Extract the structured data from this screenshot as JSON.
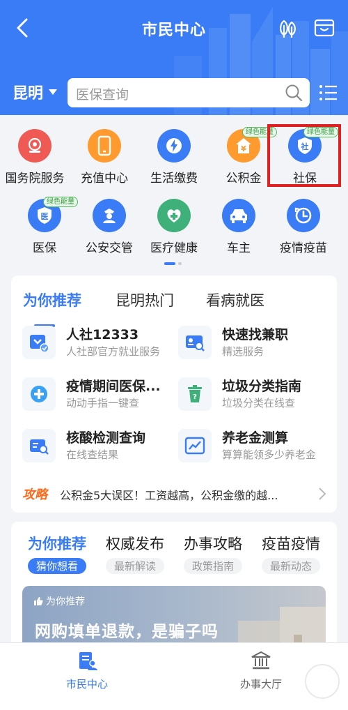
{
  "header": {
    "title": "市民中心",
    "city": "昆明",
    "search_placeholder": "医保查询"
  },
  "services": [
    {
      "label": "国务院服务",
      "icon": "state-council-icon",
      "color": "#ef5350"
    },
    {
      "label": "充值中心",
      "icon": "phone-recharge-icon",
      "color": "#ff9a2e"
    },
    {
      "label": "生活缴费",
      "icon": "lightning-icon",
      "color": "#3a7cf5"
    },
    {
      "label": "公积金",
      "icon": "yuan-house-icon",
      "color": "#ff9a2e",
      "badge": "绿色能量"
    },
    {
      "label": "社保",
      "icon": "social-security-shield-icon",
      "color": "#3a7cf5",
      "badge": "绿色能量"
    },
    {
      "label": "医保",
      "icon": "medical-insurance-shield-icon",
      "color": "#3a7cf5",
      "badge": "绿色能量"
    },
    {
      "label": "公安交管",
      "icon": "police-icon",
      "color": "#3a7cf5"
    },
    {
      "label": "医疗健康",
      "icon": "heart-cross-icon",
      "color": "#3fb07a"
    },
    {
      "label": "车主",
      "icon": "car-icon",
      "color": "#3a7cf5"
    },
    {
      "label": "疫情疫苗",
      "icon": "clock-icon",
      "color": "#3a7cf5"
    }
  ],
  "recommend": {
    "tabs": [
      "为你推荐",
      "昆明热门",
      "看病就医"
    ],
    "items": [
      {
        "title": "人社12333",
        "subtitle": "人社部官方就业服务",
        "icon": "download-check-icon"
      },
      {
        "title": "快速找兼职",
        "subtitle": "精选服务",
        "icon": "id-card-search-icon"
      },
      {
        "title": "疫情期间医保...",
        "subtitle": "动动手指一键查",
        "icon": "plus-circle-icon"
      },
      {
        "title": "垃圾分类指南",
        "subtitle": "垃圾分类在线查",
        "icon": "trash-bin-icon"
      },
      {
        "title": "核酸检测查询",
        "subtitle": "在线查结果",
        "icon": "test-search-icon"
      },
      {
        "title": "养老金测算",
        "subtitle": "算算能领多少养老金",
        "icon": "line-chart-icon"
      }
    ],
    "tip_tag": "攻略",
    "tip_text": "公积金5大误区！工资越高，公积金缴的越..."
  },
  "feed": {
    "tabs": [
      {
        "label": "为你推荐",
        "sub": "猜你想看"
      },
      {
        "label": "权威发布",
        "sub": "最新解读"
      },
      {
        "label": "办事攻略",
        "sub": "政策指南"
      },
      {
        "label": "疫苗疫情",
        "sub": "最新动态"
      }
    ],
    "feature_tag": "为你推荐",
    "feature_title": "网购填单退款，是骗子吗"
  },
  "bottom_nav": {
    "items": [
      "市民中心",
      "办事大厅"
    ]
  },
  "colors": {
    "primary": "#3a7cf5",
    "highlight": "#e02020",
    "tip": "#ff6a1a"
  }
}
